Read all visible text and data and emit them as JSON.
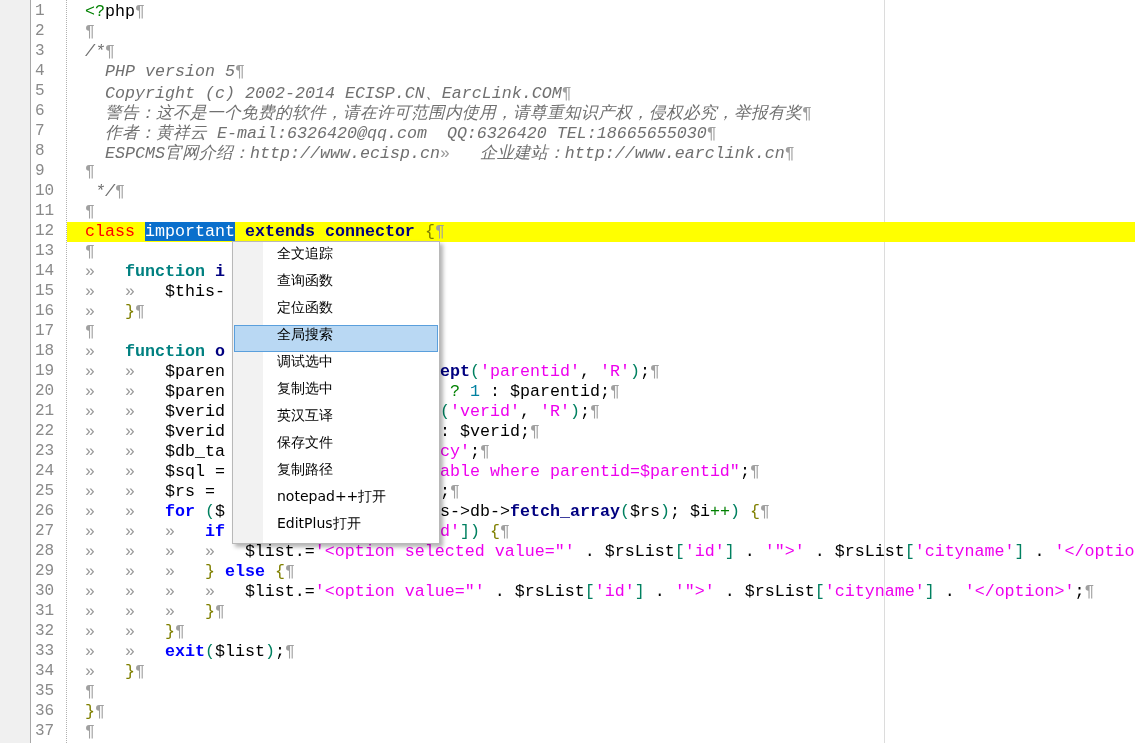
{
  "editor": {
    "lines": [
      {
        "n": "1",
        "kind": "full",
        "current": false,
        "eol": true,
        "tokens": [
          {
            "text": "<?",
            "kind": "tag"
          },
          {
            "text": "php",
            "kind": "plain"
          }
        ]
      },
      {
        "n": "2",
        "kind": "full",
        "current": false,
        "eol": true
      },
      {
        "n": "3",
        "kind": "full",
        "current": false,
        "eol": true,
        "tokens": [
          {
            "text": "/*",
            "kind": "comment"
          }
        ]
      },
      {
        "n": "4",
        "kind": "full",
        "current": false,
        "eol": true,
        "tokens": [
          {
            "text": "  PHP version 5",
            "kind": "comment"
          }
        ]
      },
      {
        "n": "5",
        "kind": "full",
        "current": false,
        "eol": true,
        "tokens": [
          {
            "text": "  Copyright (c) 2002-2014 ECISP.CN、EarcLink.COM",
            "kind": "comment"
          }
        ]
      },
      {
        "n": "6",
        "kind": "full",
        "current": false,
        "eol": true,
        "tokens": [
          {
            "text": "  警告：这不是一个免费的软件，请在许可范围内使用，请尊重知识产权，侵权必究，举报有奖",
            "kind": "comment"
          }
        ]
      },
      {
        "n": "7",
        "kind": "full",
        "current": false,
        "eol": true,
        "tokens": [
          {
            "text": "  作者：黄祥云 E-mail:6326420@qq.com  QQ:6326420 TEL:18665655030",
            "kind": "comment"
          }
        ]
      },
      {
        "n": "8",
        "kind": "full",
        "current": false,
        "eol": true,
        "tokens": [
          {
            "text": "  ESPCMS官网介绍：http://www.ecisp.cn",
            "kind": "comment"
          },
          {
            "text": "»",
            "kind": "tab"
          },
          {
            "text": "企业建站：http://www.earclink.cn",
            "kind": "comment"
          }
        ]
      },
      {
        "n": "9",
        "kind": "full",
        "current": false,
        "eol": true
      },
      {
        "n": "10",
        "kind": "full",
        "current": false,
        "eol": true,
        "tokens": [
          {
            "text": " */",
            "kind": "comment"
          }
        ]
      },
      {
        "n": "11",
        "kind": "full",
        "current": false,
        "eol": true
      },
      {
        "n": "12",
        "kind": "full",
        "current": true,
        "eol": true,
        "tokens": [
          {
            "text": "class ",
            "kind": "classkw"
          },
          {
            "text": "important",
            "kind": "sel"
          },
          {
            "text": " extends connector ",
            "kind": "name"
          },
          {
            "text": "{",
            "kind": "brace"
          }
        ]
      },
      {
        "n": "13",
        "kind": "full",
        "current": false,
        "eol": true
      },
      {
        "n": "14",
        "kind": "split",
        "current": false,
        "eol": false,
        "tokens": [
          {
            "text": "»",
            "kind": "tab"
          },
          {
            "text": "function",
            "kind": "keyword"
          },
          {
            "text": " i",
            "kind": "name"
          }
        ]
      },
      {
        "n": "15",
        "kind": "split",
        "current": false,
        "eol": false,
        "tokens": [
          {
            "text": "»",
            "kind": "tab"
          },
          {
            "text": "»",
            "kind": "tab"
          },
          {
            "text": "$this-",
            "kind": "plain"
          }
        ]
      },
      {
        "n": "16",
        "kind": "full",
        "current": false,
        "eol": true,
        "tokens": [
          {
            "text": "»",
            "kind": "tab"
          },
          {
            "text": "}",
            "kind": "brace"
          }
        ]
      },
      {
        "n": "17",
        "kind": "full",
        "current": false,
        "eol": true
      },
      {
        "n": "18",
        "kind": "split",
        "current": false,
        "eol": false,
        "tokens": [
          {
            "text": "»",
            "kind": "tab"
          },
          {
            "text": "function",
            "kind": "keyword"
          },
          {
            "text": " o",
            "kind": "name"
          }
        ]
      },
      {
        "n": "19",
        "kind": "split",
        "current": false,
        "eol": true,
        "tokens": [
          {
            "text": "»",
            "kind": "tab"
          },
          {
            "text": "»",
            "kind": "tab"
          },
          {
            "text": "$paren",
            "kind": "plain"
          }
        ],
        "after": [
          {
            "text": "ept",
            "kind": "name"
          },
          {
            "text": "(",
            "kind": "paren"
          },
          {
            "text": "'parentid'",
            "kind": "str"
          },
          {
            "text": ", ",
            "kind": "plain"
          },
          {
            "text": "'R'",
            "kind": "str"
          },
          {
            "text": ")",
            "kind": "paren"
          },
          {
            "text": ";",
            "kind": "plain"
          }
        ]
      },
      {
        "n": "20",
        "kind": "split",
        "current": false,
        "eol": true,
        "tokens": [
          {
            "text": "»",
            "kind": "tab"
          },
          {
            "text": "»",
            "kind": "tab"
          },
          {
            "text": "$paren",
            "kind": "plain"
          }
        ],
        "after": [
          {
            "text": " ? ",
            "kind": "op"
          },
          {
            "text": "1",
            "kind": "num"
          },
          {
            "text": " : $parentid;",
            "kind": "plain"
          }
        ]
      },
      {
        "n": "21",
        "kind": "split",
        "current": false,
        "eol": true,
        "tokens": [
          {
            "text": "»",
            "kind": "tab"
          },
          {
            "text": "»",
            "kind": "tab"
          },
          {
            "text": "$verid",
            "kind": "plain"
          }
        ],
        "after": [
          {
            "text": "(",
            "kind": "paren"
          },
          {
            "text": "'verid'",
            "kind": "str"
          },
          {
            "text": ", ",
            "kind": "plain"
          },
          {
            "text": "'R'",
            "kind": "str"
          },
          {
            "text": ")",
            "kind": "paren"
          },
          {
            "text": ";",
            "kind": "plain"
          }
        ]
      },
      {
        "n": "22",
        "kind": "split",
        "current": false,
        "eol": true,
        "tokens": [
          {
            "text": "»",
            "kind": "tab"
          },
          {
            "text": "»",
            "kind": "tab"
          },
          {
            "text": "$verid",
            "kind": "plain"
          }
        ],
        "after": [
          {
            "text": ": $verid;",
            "kind": "plain"
          }
        ]
      },
      {
        "n": "23",
        "kind": "split",
        "current": false,
        "eol": true,
        "tokens": [
          {
            "text": "»",
            "kind": "tab"
          },
          {
            "text": "»",
            "kind": "tab"
          },
          {
            "text": "$db_ta",
            "kind": "plain"
          }
        ],
        "after": [
          {
            "text": "cy'",
            "kind": "str"
          },
          {
            "text": ";",
            "kind": "plain"
          }
        ]
      },
      {
        "n": "24",
        "kind": "split",
        "current": false,
        "eol": true,
        "tokens": [
          {
            "text": "»",
            "kind": "tab"
          },
          {
            "text": "»",
            "kind": "tab"
          },
          {
            "text": "$sql =",
            "kind": "plain"
          }
        ],
        "after": [
          {
            "text": "able where parentid=$parentid\"",
            "kind": "str"
          },
          {
            "text": ";",
            "kind": "plain"
          }
        ]
      },
      {
        "n": "25",
        "kind": "split",
        "current": false,
        "eol": true,
        "tokens": [
          {
            "text": "»",
            "kind": "tab"
          },
          {
            "text": "»",
            "kind": "tab"
          },
          {
            "text": "$rs =",
            "kind": "plain"
          }
        ],
        "after": [
          {
            "text": ";",
            "kind": "plain"
          }
        ]
      },
      {
        "n": "26",
        "kind": "split",
        "current": false,
        "eol": true,
        "tokens": [
          {
            "text": "»",
            "kind": "tab"
          },
          {
            "text": "»",
            "kind": "tab"
          },
          {
            "text": "for ",
            "kind": "ctrl"
          },
          {
            "text": "(",
            "kind": "paren"
          },
          {
            "text": "$",
            "kind": "plain"
          }
        ],
        "after": [
          {
            "text": "s->db->",
            "kind": "plain"
          },
          {
            "text": "fetch_array",
            "kind": "name"
          },
          {
            "text": "(",
            "kind": "paren"
          },
          {
            "text": "$rs",
            "kind": "plain"
          },
          {
            "text": ")",
            "kind": "paren"
          },
          {
            "text": "; $i",
            "kind": "plain"
          },
          {
            "text": "++",
            "kind": "op"
          },
          {
            "text": ") ",
            "kind": "paren"
          },
          {
            "text": "{",
            "kind": "brace"
          }
        ]
      },
      {
        "n": "27",
        "kind": "split",
        "current": false,
        "eol": true,
        "tokens": [
          {
            "text": "»",
            "kind": "tab"
          },
          {
            "text": "»",
            "kind": "tab"
          },
          {
            "text": "»",
            "kind": "tab"
          },
          {
            "text": "if",
            "kind": "ctrl"
          }
        ],
        "after": [
          {
            "text": "d'",
            "kind": "str"
          },
          {
            "text": "]) ",
            "kind": "paren"
          },
          {
            "text": "{",
            "kind": "brace"
          }
        ]
      },
      {
        "n": "28",
        "kind": "full",
        "current": false,
        "eol": false,
        "tokens": [
          {
            "text": "»",
            "kind": "tab"
          },
          {
            "text": "»",
            "kind": "tab"
          },
          {
            "text": "»",
            "kind": "tab"
          },
          {
            "text": "»",
            "kind": "tab"
          },
          {
            "text": "$list.=",
            "kind": "plain"
          },
          {
            "text": "'<option selected value=\"'",
            "kind": "str"
          },
          {
            "text": " . $rsList",
            "kind": "plain"
          },
          {
            "text": "[",
            "kind": "paren"
          },
          {
            "text": "'id'",
            "kind": "str"
          },
          {
            "text": "]",
            "kind": "paren"
          },
          {
            "text": " . ",
            "kind": "plain"
          },
          {
            "text": "'\">'",
            "kind": "str"
          },
          {
            "text": " . $rsList",
            "kind": "plain"
          },
          {
            "text": "[",
            "kind": "paren"
          },
          {
            "text": "'cityname'",
            "kind": "str"
          },
          {
            "text": "]",
            "kind": "paren"
          },
          {
            "text": " . ",
            "kind": "plain"
          },
          {
            "text": "'</optio",
            "kind": "str"
          }
        ]
      },
      {
        "n": "29",
        "kind": "full",
        "current": false,
        "eol": true,
        "tokens": [
          {
            "text": "»",
            "kind": "tab"
          },
          {
            "text": "»",
            "kind": "tab"
          },
          {
            "text": "»",
            "kind": "tab"
          },
          {
            "text": "} ",
            "kind": "brace"
          },
          {
            "text": "else ",
            "kind": "ctrl"
          },
          {
            "text": "{",
            "kind": "brace"
          }
        ]
      },
      {
        "n": "30",
        "kind": "full",
        "current": false,
        "eol": true,
        "tokens": [
          {
            "text": "»",
            "kind": "tab"
          },
          {
            "text": "»",
            "kind": "tab"
          },
          {
            "text": "»",
            "kind": "tab"
          },
          {
            "text": "»",
            "kind": "tab"
          },
          {
            "text": "$list.=",
            "kind": "plain"
          },
          {
            "text": "'<option value=\"'",
            "kind": "str"
          },
          {
            "text": " . $rsList",
            "kind": "plain"
          },
          {
            "text": "[",
            "kind": "paren"
          },
          {
            "text": "'id'",
            "kind": "str"
          },
          {
            "text": "]",
            "kind": "paren"
          },
          {
            "text": " . ",
            "kind": "plain"
          },
          {
            "text": "'\">'",
            "kind": "str"
          },
          {
            "text": " . $rsList",
            "kind": "plain"
          },
          {
            "text": "[",
            "kind": "paren"
          },
          {
            "text": "'cityname'",
            "kind": "str"
          },
          {
            "text": "]",
            "kind": "paren"
          },
          {
            "text": " . ",
            "kind": "plain"
          },
          {
            "text": "'</option>'",
            "kind": "str"
          },
          {
            "text": ";",
            "kind": "plain"
          }
        ]
      },
      {
        "n": "31",
        "kind": "full",
        "current": false,
        "eol": true,
        "tokens": [
          {
            "text": "»",
            "kind": "tab"
          },
          {
            "text": "»",
            "kind": "tab"
          },
          {
            "text": "»",
            "kind": "tab"
          },
          {
            "text": "}",
            "kind": "brace"
          }
        ]
      },
      {
        "n": "32",
        "kind": "full",
        "current": false,
        "eol": true,
        "tokens": [
          {
            "text": "»",
            "kind": "tab"
          },
          {
            "text": "»",
            "kind": "tab"
          },
          {
            "text": "}",
            "kind": "brace"
          }
        ]
      },
      {
        "n": "33",
        "kind": "full",
        "current": false,
        "eol": true,
        "tokens": [
          {
            "text": "»",
            "kind": "tab"
          },
          {
            "text": "»",
            "kind": "tab"
          },
          {
            "text": "exit",
            "kind": "ctrl"
          },
          {
            "text": "(",
            "kind": "paren"
          },
          {
            "text": "$list",
            "kind": "plain"
          },
          {
            "text": ")",
            "kind": "paren"
          },
          {
            "text": ";",
            "kind": "plain"
          }
        ]
      },
      {
        "n": "34",
        "kind": "full",
        "current": false,
        "eol": true,
        "tokens": [
          {
            "text": "»",
            "kind": "tab"
          },
          {
            "text": "}",
            "kind": "brace"
          }
        ]
      },
      {
        "n": "35",
        "kind": "full",
        "current": false,
        "eol": true
      },
      {
        "n": "36",
        "kind": "full",
        "current": false,
        "eol": true,
        "tokens": [
          {
            "text": "}",
            "kind": "brace"
          }
        ]
      },
      {
        "n": "37",
        "kind": "full",
        "current": false,
        "eol": true
      }
    ]
  },
  "eol_mark": "¶",
  "context_menu": {
    "items": [
      {
        "label": "全文追踪",
        "selected": false
      },
      {
        "label": "查询函数",
        "selected": false
      },
      {
        "label": "定位函数",
        "selected": false
      },
      {
        "label": "全局搜索",
        "selected": true
      },
      {
        "label": "调试选中",
        "selected": false
      },
      {
        "label": "复制选中",
        "selected": false
      },
      {
        "label": "英汉互译",
        "selected": false
      },
      {
        "label": "保存文件",
        "selected": false
      },
      {
        "label": "复制路径",
        "selected": false
      },
      {
        "label": "notepad++打开",
        "selected": false
      },
      {
        "label": "EditPlus打开",
        "selected": false
      }
    ]
  }
}
